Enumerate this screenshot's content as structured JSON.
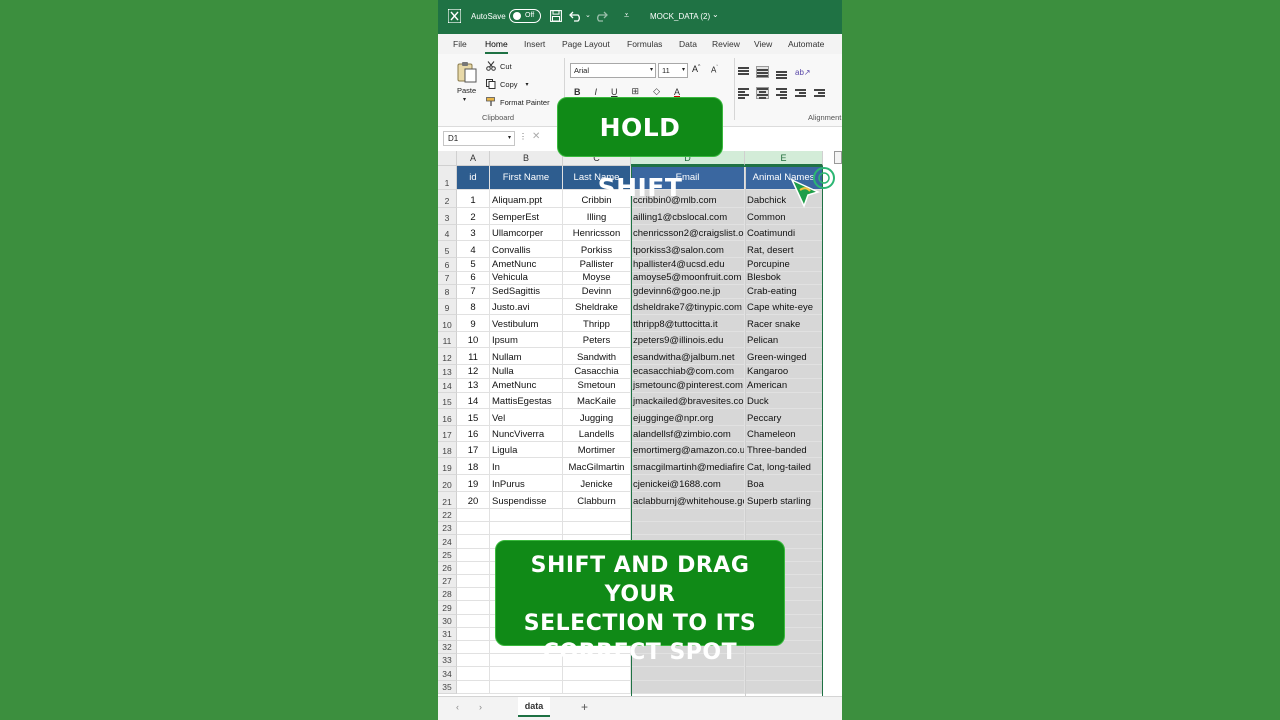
{
  "titlebar": {
    "autosave_label": "AutoSave",
    "autosave_state": "Off",
    "document_title": "MOCK_DATA (2)",
    "icons": [
      "excel-logo-icon",
      "save-icon",
      "undo-icon",
      "redo-icon",
      "customize-qat-icon"
    ]
  },
  "ribbon_tabs": [
    "File",
    "Home",
    "Insert",
    "Page Layout",
    "Formulas",
    "Data",
    "Review",
    "View",
    "Automate"
  ],
  "active_tab": "Home",
  "ribbon": {
    "paste_label": "Paste",
    "cut_label": "Cut",
    "copy_label": "Copy",
    "format_painter_label": "Format Painter",
    "clipboard_group_label": "Clipboard",
    "font_name": "Arial",
    "font_size": "11",
    "bold_label": "B",
    "alignment_group_label": "Alignment"
  },
  "formula_bar": {
    "name_box": "D1",
    "dots": "⋮",
    "cancel": "✕"
  },
  "columns": [
    "A",
    "B",
    "C",
    "D",
    "E"
  ],
  "headers": [
    "id",
    "First Name",
    "Last Name",
    "Email",
    "Animal Names"
  ],
  "rows": [
    [
      "1",
      "Aliquam.ppt",
      "Cribbin",
      "ccribbin0@mlb.com",
      "Dabchick"
    ],
    [
      "2",
      "SemperEst",
      "Illing",
      "ailling1@cbslocal.com",
      "Common"
    ],
    [
      "3",
      "Ullamcorper",
      "Henricsson",
      "chenricsson2@craigslist.org",
      "Coatimundi"
    ],
    [
      "4",
      "Convallis",
      "Porkiss",
      "tporkiss3@salon.com",
      "Rat, desert"
    ],
    [
      "5",
      "AmetNunc",
      "Pallister",
      "hpallister4@ucsd.edu",
      "Porcupine"
    ],
    [
      "6",
      "Vehicula",
      "Moyse",
      "amoyse5@moonfruit.com",
      "Blesbok"
    ],
    [
      "7",
      "SedSagittis",
      "Devinn",
      "gdevinn6@goo.ne.jp",
      "Crab-eating"
    ],
    [
      "8",
      "Justo.avi",
      "Sheldrake",
      "dsheldrake7@tinypic.com",
      "Cape white-eye"
    ],
    [
      "9",
      "Vestibulum",
      "Thripp",
      "tthripp8@tuttocitta.it",
      "Racer snake"
    ],
    [
      "10",
      "Ipsum",
      "Peters",
      "zpeters9@illinois.edu",
      "Pelican"
    ],
    [
      "11",
      "Nullam",
      "Sandwith",
      "esandwitha@jalbum.net",
      "Green-winged"
    ],
    [
      "12",
      "Nulla",
      "Casacchia",
      "ecasacchiab@com.com",
      "Kangaroo"
    ],
    [
      "13",
      "AmetNunc",
      "Smetoun",
      "jsmetounc@pinterest.com",
      "American"
    ],
    [
      "14",
      "MattisEgestas",
      "MacKaile",
      "jmackailed@bravesites.com",
      "Duck"
    ],
    [
      "15",
      "Vel",
      "Jugging",
      "ejugginge@npr.org",
      "Peccary"
    ],
    [
      "16",
      "NuncViverra",
      "Landells",
      "alandellsf@zimbio.com",
      "Chameleon"
    ],
    [
      "17",
      "Ligula",
      "Mortimer",
      "emortimerg@amazon.co.uk",
      "Three-banded"
    ],
    [
      "18",
      "In",
      "MacGilmartin",
      "smacgilmartinh@mediafire.com",
      "Cat, long-tailed"
    ],
    [
      "19",
      "InPurus",
      "Jenicke",
      "cjenickei@1688.com",
      "Boa"
    ],
    [
      "20",
      "Suspendisse",
      "Clabburn",
      "aclabburnj@whitehouse.gov",
      "Superb starling"
    ]
  ],
  "row_numbers": [
    "1",
    "2",
    "3",
    "4",
    "5",
    "6",
    "7",
    "8",
    "9",
    "10",
    "11",
    "12",
    "13",
    "14",
    "15",
    "16",
    "17",
    "18",
    "19",
    "20",
    "21",
    "22",
    "23",
    "24",
    "25",
    "26",
    "27",
    "28",
    "29",
    "30",
    "31",
    "32",
    "33",
    "34",
    "35"
  ],
  "sheet_tabs": {
    "active": "data",
    "prev": "‹",
    "next": "›",
    "add": "+"
  },
  "callouts": {
    "top": "HOLD SHIFT",
    "bottom_lines": [
      "SHIFT AND DRAG YOUR",
      "SELECTION TO ITS",
      "CORRECT SPOT"
    ]
  },
  "colors": {
    "background": "#3c8f3e",
    "excel_green": "#1f7244",
    "header_fill": "#2e5d8f",
    "callout_fill": "#108a17",
    "selection_fill": "#d7d7d7"
  }
}
